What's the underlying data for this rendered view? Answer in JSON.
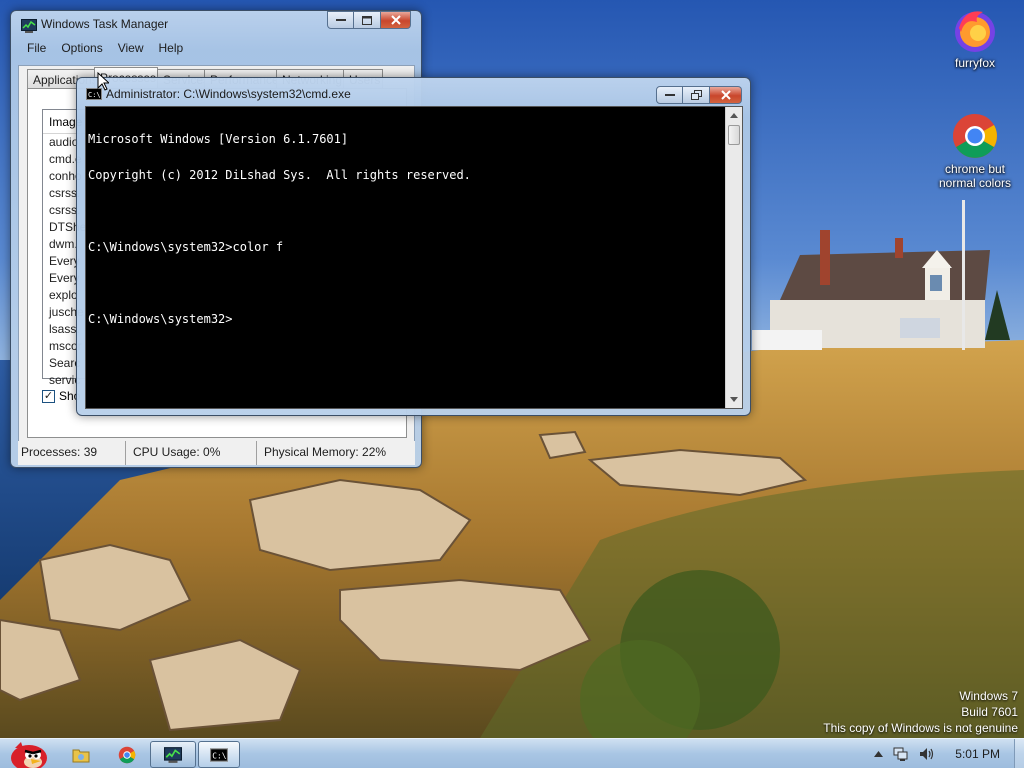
{
  "desktop": {
    "icons": [
      {
        "label": "furryfox",
        "icon": "firefox-icon"
      },
      {
        "label": "chrome but normal colors",
        "icon": "chrome-icon"
      }
    ],
    "watermark": {
      "line1": "Windows 7",
      "line2": "Build 7601",
      "line3": "This copy of Windows is not genuine"
    }
  },
  "task_manager": {
    "title": "Windows Task Manager",
    "menu": [
      "File",
      "Options",
      "View",
      "Help"
    ],
    "tabs": [
      "Applications",
      "Processes",
      "Services",
      "Performance",
      "Networking",
      "Users"
    ],
    "active_tab": "Processes",
    "column_header": "Image",
    "processes": [
      "audio",
      "cmd.e",
      "conho",
      "csrss.",
      "csrss.",
      "DTShe",
      "dwm.",
      "Every",
      "Every",
      "explo",
      "jusche",
      "lsass.",
      "mscor",
      "Searc",
      "servic"
    ],
    "show_all_label": "Sho",
    "show_all_checked": true,
    "status": {
      "processes": "Processes: 39",
      "cpu": "CPU Usage: 0%",
      "memory": "Physical Memory: 22%"
    }
  },
  "cmd": {
    "title": "Administrator: C:\\Windows\\system32\\cmd.exe",
    "lines": [
      "Microsoft Windows [Version 6.1.7601]",
      "Copyright (c) 2012 DiLshad Sys.  All rights reserved.",
      "",
      "C:\\Windows\\system32>color f",
      "",
      "C:\\Windows\\system32>"
    ]
  },
  "taskbar": {
    "start_icon": "angry-bird-start-icon",
    "pinned": [
      {
        "name": "explorer-icon"
      },
      {
        "name": "chrome-icon"
      },
      {
        "name": "task-manager-icon"
      },
      {
        "name": "cmd-icon"
      }
    ],
    "tray": {
      "clock": "5:01 PM"
    }
  },
  "colors": {
    "cmd_background": "#000000",
    "cmd_text": "#ffffff",
    "taskbar": "#a9c6e4"
  }
}
